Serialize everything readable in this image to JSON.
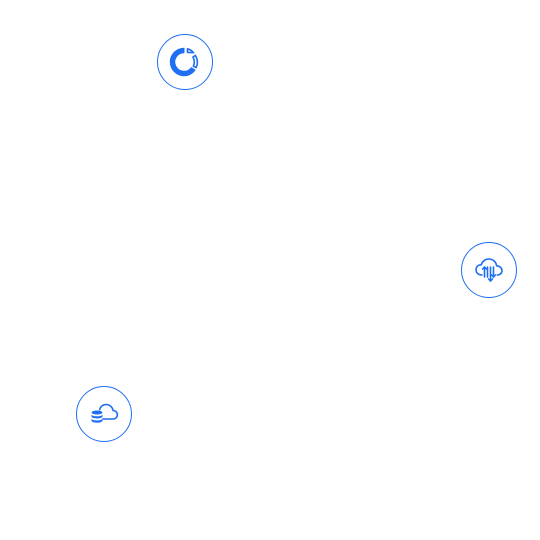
{
  "colors": {
    "accent": "#1f6ff2",
    "background": "#ffffff"
  },
  "icons": [
    {
      "id": "badge-chart",
      "icon": "pie-chart-icon"
    },
    {
      "id": "badge-cloud-transfer",
      "icon": "cloud-transfer-icon"
    },
    {
      "id": "badge-cloud-database",
      "icon": "cloud-database-icon"
    }
  ]
}
